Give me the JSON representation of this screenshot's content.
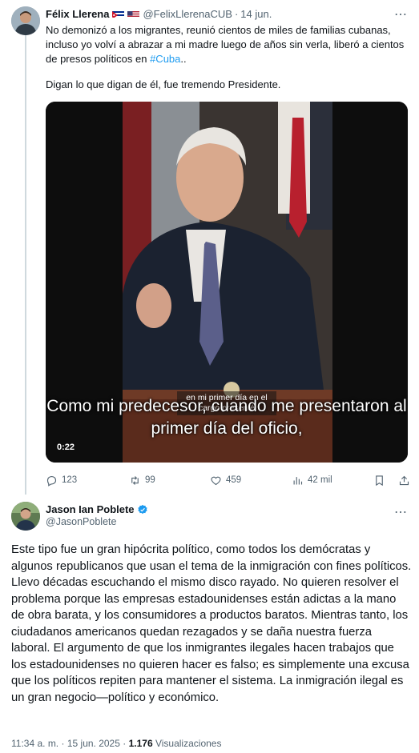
{
  "parent_tweet": {
    "author_name": "Félix Llerena",
    "author_handle": "@FelixLlerenaCUB",
    "separator": "·",
    "time": "14 jun.",
    "text_line1_a": "No demonizó a los migrantes, reunió cientos de miles de familias cubanas, incluso yo volví a abrazar a mi madre luego de años sin verla, liberó a cientos de presos políticos en ",
    "hashtag": "#Cuba",
    "text_line1_b": "..",
    "text_line2": "Digan lo que digan de él, fue tremendo Presidente.",
    "video": {
      "inner_caption": "en mi primer día en el cargo presenté",
      "subtitle": "Como mi predecesor, cuando me presentaron al primer día del oficio,",
      "duration": "0:22"
    },
    "actions": {
      "replies": "123",
      "reposts": "99",
      "likes": "459",
      "views": "42 mil"
    },
    "icons": [
      "reply-icon",
      "repost-icon",
      "like-icon",
      "views-icon",
      "bookmark-icon",
      "share-icon",
      "more-icon"
    ]
  },
  "main_tweet": {
    "author_name": "Jason Ian Poblete",
    "author_handle": "@JasonPoblete",
    "body": "Este tipo fue un gran hipócrita político, como todos los demócratas y algunos republicanos que usan el tema de la inmigración con fines políticos. Llevo décadas escuchando el mismo disco rayado. No quieren resolver el problema porque las empresas estadounidenses están adictas a la mano de obra barata, y los consumidores a productos baratos. Mientras tanto, los ciudadanos americanos quedan rezagados y se daña nuestra fuerza laboral. El argumento de que los inmigrantes ilegales hacen trabajos que los estadounidenses no quieren hacer es falso; es simplemente una excusa que los políticos repiten para mantener el sistema. La inmigración ilegal es un gran negocio—político y económico.",
    "time": "11:34 a. m.",
    "separator": "·",
    "date": "15 jun. 2025",
    "views_count": "1.176",
    "views_label": "Visualizaciones"
  },
  "colors": {
    "accent": "#1d9bf0",
    "text_primary": "#0f1419",
    "text_secondary": "#536471",
    "thread_line": "#cfd9de"
  }
}
